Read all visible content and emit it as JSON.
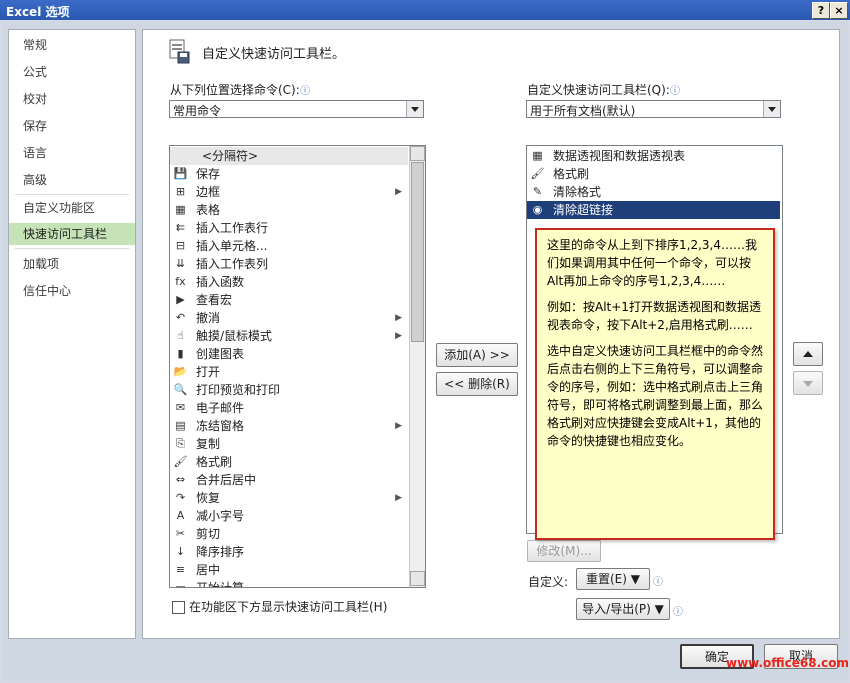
{
  "window": {
    "title": "Excel 选项",
    "help_btn": "?",
    "close_btn": "×"
  },
  "nav": [
    {
      "label": "常规"
    },
    {
      "label": "公式"
    },
    {
      "label": "校对"
    },
    {
      "label": "保存"
    },
    {
      "label": "语言"
    },
    {
      "label": "高级"
    },
    {
      "label": "自定义功能区"
    },
    {
      "label": "快速访问工具栏",
      "selected": true
    },
    {
      "label": "加载项"
    },
    {
      "label": "信任中心"
    }
  ],
  "header": {
    "title": "自定义快速访问工具栏。"
  },
  "left": {
    "choose_label": "从下列位置选择命令(C):",
    "choose_value": "常用命令",
    "commands": [
      {
        "label": "<分隔符>",
        "icon": "",
        "separator": true
      },
      {
        "label": "保存",
        "icon": "save-icon",
        "glyph": "💾"
      },
      {
        "label": "边框",
        "icon": "border-icon",
        "glyph": "⊞",
        "submenu": true
      },
      {
        "label": "表格",
        "icon": "table-icon",
        "glyph": "▦"
      },
      {
        "label": "插入工作表行",
        "icon": "insert-row-icon",
        "glyph": "⇇"
      },
      {
        "label": "插入单元格...",
        "icon": "insert-cells-icon",
        "glyph": "⊟"
      },
      {
        "label": "插入工作表列",
        "icon": "insert-column-icon",
        "glyph": "⇊"
      },
      {
        "label": "插入函数",
        "icon": "function-icon",
        "glyph": "fx"
      },
      {
        "label": "查看宏",
        "icon": "macro-icon",
        "glyph": "▶"
      },
      {
        "label": "撤消",
        "icon": "undo-icon",
        "glyph": "↶",
        "submenu": true
      },
      {
        "label": "触摸/鼠标模式",
        "icon": "touch-icon",
        "glyph": "☝",
        "submenu": true
      },
      {
        "label": "创建图表",
        "icon": "chart-icon",
        "glyph": "▮"
      },
      {
        "label": "打开",
        "icon": "open-icon",
        "glyph": "📂"
      },
      {
        "label": "打印预览和打印",
        "icon": "print-preview-icon",
        "glyph": "🔍"
      },
      {
        "label": "电子邮件",
        "icon": "email-icon",
        "glyph": "✉"
      },
      {
        "label": "冻结窗格",
        "icon": "freeze-icon",
        "glyph": "▤",
        "submenu": true
      },
      {
        "label": "复制",
        "icon": "copy-icon",
        "glyph": "⎘"
      },
      {
        "label": "格式刷",
        "icon": "format-painter-icon",
        "glyph": "🖌"
      },
      {
        "label": "合并后居中",
        "icon": "merge-center-icon",
        "glyph": "⇔"
      },
      {
        "label": "恢复",
        "icon": "redo-icon",
        "glyph": "↷",
        "submenu": true
      },
      {
        "label": "减小字号",
        "icon": "font-shrink-icon",
        "glyph": "A"
      },
      {
        "label": "剪切",
        "icon": "cut-icon",
        "glyph": "✂"
      },
      {
        "label": "降序排序",
        "icon": "sort-desc-icon",
        "glyph": "↓"
      },
      {
        "label": "居中",
        "icon": "center-icon",
        "glyph": "≡"
      },
      {
        "label": "开始计算",
        "icon": "calc-icon",
        "glyph": "▭"
      }
    ],
    "show_below_label": "在功能区下方显示快速访问工具栏(H)"
  },
  "middle": {
    "add_btn": "添加(A) >>",
    "remove_btn": "<< 删除(R)"
  },
  "right": {
    "customize_label": "自定义快速访问工具栏(Q):",
    "customize_value": "用于所有文档(默认)",
    "items": [
      {
        "label": "数据透视图和数据透视表",
        "icon": "pivot-icon",
        "glyph": "▦"
      },
      {
        "label": "格式刷",
        "icon": "format-painter-icon",
        "glyph": "🖌"
      },
      {
        "label": "清除格式",
        "icon": "clear-format-icon",
        "glyph": "✎"
      },
      {
        "label": "清除超链接",
        "icon": "clear-hyperlink-icon",
        "glyph": "◉",
        "selected": true
      }
    ],
    "modify_btn": "修改(M)...",
    "custom_label": "自定义:",
    "reset_btn": "重置(E) ▼",
    "import_export_btn": "导入/导出(P) ▼"
  },
  "callout": {
    "p1": "这里的命令从上到下排序1,2,3,4……我们如果调用其中任何一个命令，可以按Alt再加上命令的序号1,2,3,4……",
    "p2": "例如：按Alt+1打开数据透视图和数据透视表命令，按下Alt+2,启用格式刷……",
    "p3": "选中自定义快速访问工具栏框中的命令然后点击右侧的上下三角符号，可以调整命令的序号，例如：选中格式刷点击上三角符号，即可将格式刷调整到最上面，那么格式刷对应快捷键会变成Alt+1，其他的命令的快捷键也相应变化。"
  },
  "footer": {
    "ok_btn": "确定",
    "cancel_btn": "取消"
  },
  "watermark": "www.office68.com"
}
